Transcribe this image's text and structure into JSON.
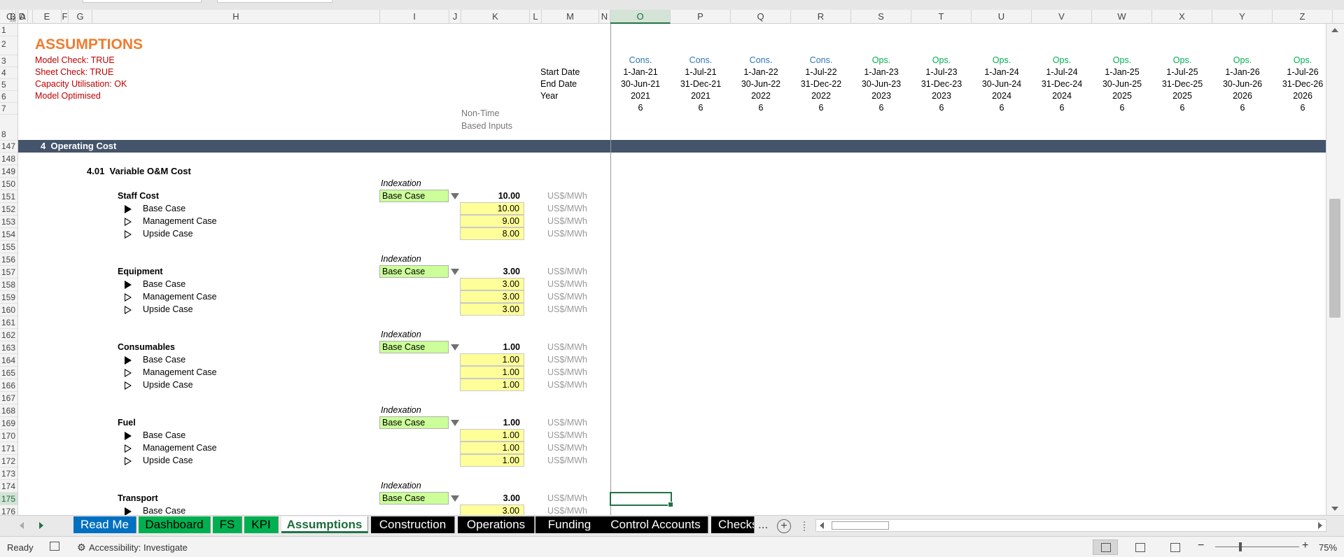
{
  "window": {
    "top_tabs": [
      "",
      ""
    ]
  },
  "columns": [
    "A",
    "B",
    "C",
    "D",
    "E",
    "F",
    "G",
    "H",
    "I",
    "J",
    "K",
    "L",
    "M",
    "N",
    "O",
    "P",
    "Q",
    "R",
    "S",
    "T",
    "U",
    "V",
    "W",
    "X",
    "Y",
    "Z"
  ],
  "selected_column": "O",
  "rows": [
    "1",
    "2",
    "3",
    "4",
    "5",
    "6",
    "7",
    "8",
    "147",
    "148",
    "149",
    "150",
    "151",
    "152",
    "153",
    "154",
    "155",
    "156",
    "157",
    "158",
    "159",
    "160",
    "161",
    "162",
    "163",
    "164",
    "165",
    "166",
    "167",
    "168",
    "169",
    "170",
    "171",
    "172",
    "173",
    "174",
    "175",
    "176"
  ],
  "selected_row": "175",
  "header": {
    "title": "ASSUMPTIONS",
    "checks": [
      "Model Check: TRUE",
      "Sheet Check: TRUE",
      "Capacity Utilisation: OK",
      "Model Optimised"
    ],
    "row_labels": [
      "Start Date",
      "End Date",
      "Year"
    ],
    "non_time_line1": "Non-Time",
    "non_time_line2": "Based Inputs"
  },
  "timeline": [
    {
      "phase": "Cons.",
      "start": "1-Jan-21",
      "end": "30-Jun-21",
      "year": "2021",
      "months": "6"
    },
    {
      "phase": "Cons.",
      "start": "1-Jul-21",
      "end": "31-Dec-21",
      "year": "2021",
      "months": "6"
    },
    {
      "phase": "Cons.",
      "start": "1-Jan-22",
      "end": "30-Jun-22",
      "year": "2022",
      "months": "6"
    },
    {
      "phase": "Cons.",
      "start": "1-Jul-22",
      "end": "31-Dec-22",
      "year": "2022",
      "months": "6"
    },
    {
      "phase": "Ops.",
      "start": "1-Jan-23",
      "end": "30-Jun-23",
      "year": "2023",
      "months": "6"
    },
    {
      "phase": "Ops.",
      "start": "1-Jul-23",
      "end": "31-Dec-23",
      "year": "2023",
      "months": "6"
    },
    {
      "phase": "Ops.",
      "start": "1-Jan-24",
      "end": "30-Jun-24",
      "year": "2024",
      "months": "6"
    },
    {
      "phase": "Ops.",
      "start": "1-Jul-24",
      "end": "31-Dec-24",
      "year": "2024",
      "months": "6"
    },
    {
      "phase": "Ops.",
      "start": "1-Jan-25",
      "end": "30-Jun-25",
      "year": "2025",
      "months": "6"
    },
    {
      "phase": "Ops.",
      "start": "1-Jul-25",
      "end": "31-Dec-25",
      "year": "2025",
      "months": "6"
    },
    {
      "phase": "Ops.",
      "start": "1-Jan-26",
      "end": "30-Jun-26",
      "year": "2026",
      "months": "6"
    },
    {
      "phase": "Ops.",
      "start": "1-Jul-26",
      "end": "31-Dec-26",
      "year": "2026",
      "months": "6"
    }
  ],
  "section": {
    "number": "4",
    "title": "Operating Cost"
  },
  "subsection": {
    "number": "4.01",
    "title": "Variable O&M Cost"
  },
  "indexation_label": "Indexation",
  "unit": "US$/MWh",
  "cost_items": [
    {
      "name": "Staff Cost",
      "selection": "Base Case",
      "value": "10.00",
      "cases": [
        {
          "label": "Base Case",
          "value": "10.00",
          "active": true
        },
        {
          "label": "Management Case",
          "value": "9.00",
          "active": false
        },
        {
          "label": "Upside Case",
          "value": "8.00",
          "active": false
        }
      ]
    },
    {
      "name": "Equipment",
      "selection": "Base Case",
      "value": "3.00",
      "cases": [
        {
          "label": "Base Case",
          "value": "3.00",
          "active": true
        },
        {
          "label": "Management Case",
          "value": "3.00",
          "active": false
        },
        {
          "label": "Upside Case",
          "value": "3.00",
          "active": false
        }
      ]
    },
    {
      "name": "Consumables",
      "selection": "Base Case",
      "value": "1.00",
      "cases": [
        {
          "label": "Base Case",
          "value": "1.00",
          "active": true
        },
        {
          "label": "Management Case",
          "value": "1.00",
          "active": false
        },
        {
          "label": "Upside Case",
          "value": "1.00",
          "active": false
        }
      ]
    },
    {
      "name": "Fuel",
      "selection": "Base Case",
      "value": "1.00",
      "cases": [
        {
          "label": "Base Case",
          "value": "1.00",
          "active": true
        },
        {
          "label": "Management Case",
          "value": "1.00",
          "active": false
        },
        {
          "label": "Upside Case",
          "value": "1.00",
          "active": false
        }
      ]
    },
    {
      "name": "Transport",
      "selection": "Base Case",
      "value": "3.00",
      "cases": [
        {
          "label": "Base Case",
          "value": "3.00",
          "active": true
        }
      ]
    }
  ],
  "sheet_tabs": [
    {
      "label": "Read Me",
      "bg": "#0070c0",
      "fg": "#ffffff"
    },
    {
      "label": "Dashboard",
      "bg": "#00b050",
      "fg": "#000000"
    },
    {
      "label": "FS",
      "bg": "#00b050",
      "fg": "#000000"
    },
    {
      "label": "KPI",
      "bg": "#00b050",
      "fg": "#000000"
    },
    {
      "label": "Assumptions",
      "bg": "#ffffff",
      "fg": "#1d6b3b",
      "active": true
    },
    {
      "label": "Construction",
      "bg": "#000000",
      "fg": "#ffffff"
    },
    {
      "label": "Operations",
      "bg": "#000000",
      "fg": "#ffffff"
    },
    {
      "label": "Funding",
      "bg": "#000000",
      "fg": "#ffffff"
    },
    {
      "label": "Control Accounts",
      "bg": "#000000",
      "fg": "#ffffff"
    },
    {
      "label": "Checks",
      "bg": "#000000",
      "fg": "#ffffff"
    }
  ],
  "tab_more": "...",
  "add_sheet": "+",
  "status": {
    "ready": "Ready",
    "accessibility": "Accessibility: Investigate",
    "zoom": "75%"
  },
  "colors": {
    "title": "#ed7d31",
    "check": "#c00000",
    "cons": "#2e75b6",
    "ops": "#00b050",
    "section_bar": "#44546a",
    "input": "#ffff99",
    "selector": "#ccff99",
    "excel_green": "#217346"
  }
}
